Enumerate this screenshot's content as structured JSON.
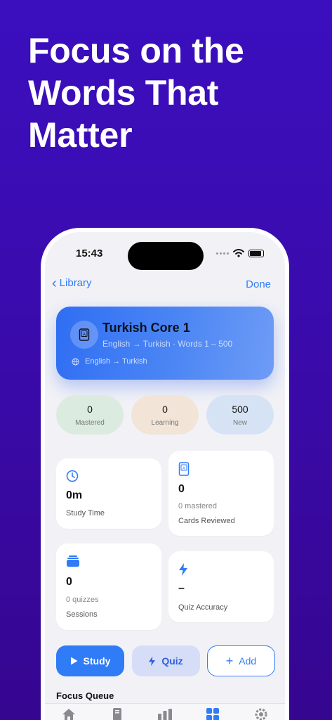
{
  "headline": "Focus on the Words That Matter",
  "status_bar": {
    "time": "15:43"
  },
  "nav": {
    "back_label": "Library",
    "done_label": "Done"
  },
  "deck": {
    "title": "Turkish Core 1",
    "subtitle": "English → Turkish · Words 1 – 500",
    "language_pair": "English → Turkish",
    "icon": "book-icon"
  },
  "pills": [
    {
      "value": "0",
      "label": "Mastered",
      "color": "#dcebdf"
    },
    {
      "value": "0",
      "label": "Learning",
      "color": "#f2e5d8"
    },
    {
      "value": "500",
      "label": "New",
      "color": "#d6e3f4"
    }
  ],
  "stats": {
    "study_time": {
      "value": "0m",
      "caption": "Study Time",
      "icon": "clock-icon"
    },
    "cards_reviewed": {
      "value": "0",
      "sub": "0 mastered",
      "caption": "Cards Reviewed",
      "icon": "flashcard-icon"
    },
    "sessions": {
      "value": "0",
      "sub": "0 quizzes",
      "caption": "Sessions",
      "icon": "stack-icon"
    },
    "quiz_accuracy": {
      "value": "–",
      "caption": "Quiz Accuracy",
      "icon": "bolt-icon"
    }
  },
  "actions": {
    "study_label": "Study",
    "quiz_label": "Quiz",
    "add_label": "Add"
  },
  "section_title": "Focus Queue",
  "tabs": [
    "home-icon",
    "library-icon",
    "stats-icon",
    "dashboard-icon",
    "settings-icon"
  ],
  "colors": {
    "accent": "#2f7cf6",
    "background": "#3a0aa8"
  }
}
